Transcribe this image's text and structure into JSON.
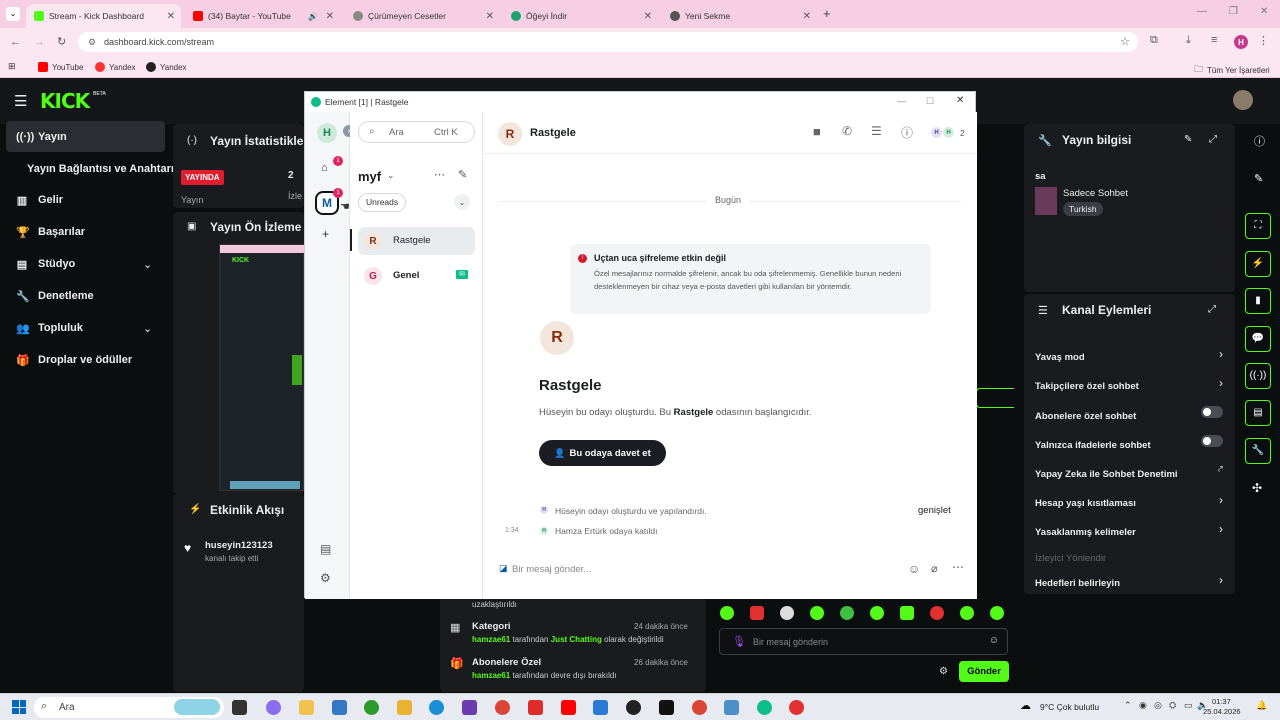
{
  "browser": {
    "tabs": [
      {
        "label": "Stream - Kick Dashboard",
        "color": "#53fc18"
      },
      {
        "label": "(34) Baytar - YouTube",
        "color": "#ff0000"
      },
      {
        "label": "Çürümeyen Cesetler",
        "color": "#888888"
      },
      {
        "label": "Öğeyi İndir",
        "color": "#1aa36f"
      },
      {
        "label": "Yeni Sekme",
        "color": "#555555"
      }
    ],
    "url": "dashboard.kick.com/stream",
    "profile_initial": "H",
    "bookmarks": [
      "YouTube",
      "Yandex",
      "Yandex"
    ],
    "all_bookmarks": "Tüm Yer İşaretleri"
  },
  "kick": {
    "logo": "KICK",
    "beta": "BETA",
    "nav": [
      {
        "label": "Yayın",
        "icon": "broadcast-icon"
      },
      {
        "label": "Yayın Bağlantısı ve Anahtarı",
        "icon": ""
      },
      {
        "label": "Gelir",
        "icon": "chart-icon"
      },
      {
        "label": "Başarılar",
        "icon": "trophy-icon"
      },
      {
        "label": "Stüdyo",
        "icon": "studio-icon"
      },
      {
        "label": "Denetleme",
        "icon": "wrench-icon"
      },
      {
        "label": "Topluluk",
        "icon": "community-icon"
      },
      {
        "label": "Droplar ve ödüller",
        "icon": "gift-icon"
      }
    ],
    "stats_title": "Yayın İstatistikle",
    "live_badge": "YAYINDA",
    "stat_value": "2",
    "stat_label1": "Yayın",
    "stat_label2": "İzle",
    "preview_title": "Yayın Ön İzleme",
    "activity_title": "Etkinlik Akışı",
    "activity_user": "huseyin123123",
    "activity_text": "kanalı takip etti",
    "feed": [
      {
        "text": "uzaklaştırıldı"
      },
      {
        "title": "Kategori",
        "time": "24 dakika önce",
        "user": "hamzae61",
        "mid": " tarafından ",
        "hl": "Just Chatting",
        "end": " olarak değiştirildi"
      },
      {
        "title": "Abonelere Özel",
        "time": "26 dakika önce",
        "user": "hamzae61",
        "mid": " tarafından devre dışı bırakıldı",
        "hl": "",
        "end": ""
      }
    ],
    "info_title": "Yayın bilgisi",
    "info_short": "sa",
    "info_channel": "Sadece Sohbet",
    "info_lang": "Turkish",
    "actions_title": "Kanal Eylemleri",
    "actions": [
      {
        "label": "Yavaş mod",
        "type": "chevron"
      },
      {
        "label": "Takipçilere özel sohbet",
        "type": "chevron"
      },
      {
        "label": "Abonelere özel sohbet",
        "type": "toggle"
      },
      {
        "label": "Yalnızca ifadelerle sohbet",
        "type": "toggle"
      },
      {
        "label": "Yapay Zeka ile Sohbet Denetimi",
        "type": "link"
      },
      {
        "label": "Hesap yaşı kısıtlaması",
        "type": "chevron"
      },
      {
        "label": "Yasaklanmış kelimeler",
        "type": "chevron"
      },
      {
        "label": "İzleyici Yönlendir",
        "type": "disabled"
      },
      {
        "label": "Hedefleri belirleyin",
        "type": "chevron"
      }
    ],
    "chat_placeholder": "Bir mesaj gönderin",
    "send_label": "Gönder"
  },
  "element": {
    "title": "Element [1] | Rastgele",
    "search_placeholder": "Ara",
    "search_shortcut": "Ctrl K",
    "space_name": "myf",
    "filter": "Unreads",
    "rooms": [
      {
        "initial": "R",
        "name": "Rastgele",
        "active": true
      },
      {
        "initial": "G",
        "name": "Genel",
        "active": false
      }
    ],
    "user_initial": "H",
    "space_initial": "M",
    "room_name": "Rastgele",
    "room_initial": "R",
    "member_count": "2",
    "date_sep": "Bugün",
    "e2e_title": "Uçtan uca şifreleme etkin değil",
    "e2e_body": "Özel mesajlarınız normalde şifrelenir, ancak bu oda şifrelenmemiş. Genellikle bunun nedeni desteklenmeyen bir cihaz veya e-posta davetleri gibi kullanılan bir yöntemdir.",
    "intro_name": "Rastgele",
    "intro_pre": "Hüseyin bu odayı oluşturdu. Bu ",
    "intro_bold": "Rastgele",
    "intro_post": " odasının başlangıcıdır.",
    "invite_label": "Bu odaya davet et",
    "event1": "Hüseyin odayı oluşturdu ve yapılandırdı.",
    "expand": "genişlet",
    "event_time": "1:34",
    "event2": "Hamza Ertürk odaya katıldı",
    "composer_placeholder": "Bir mesaj gönder..."
  },
  "taskbar": {
    "search": "Ara",
    "weather": "9°C  Çok bulutlu",
    "time": "01:37",
    "date": "25.04.2026"
  }
}
